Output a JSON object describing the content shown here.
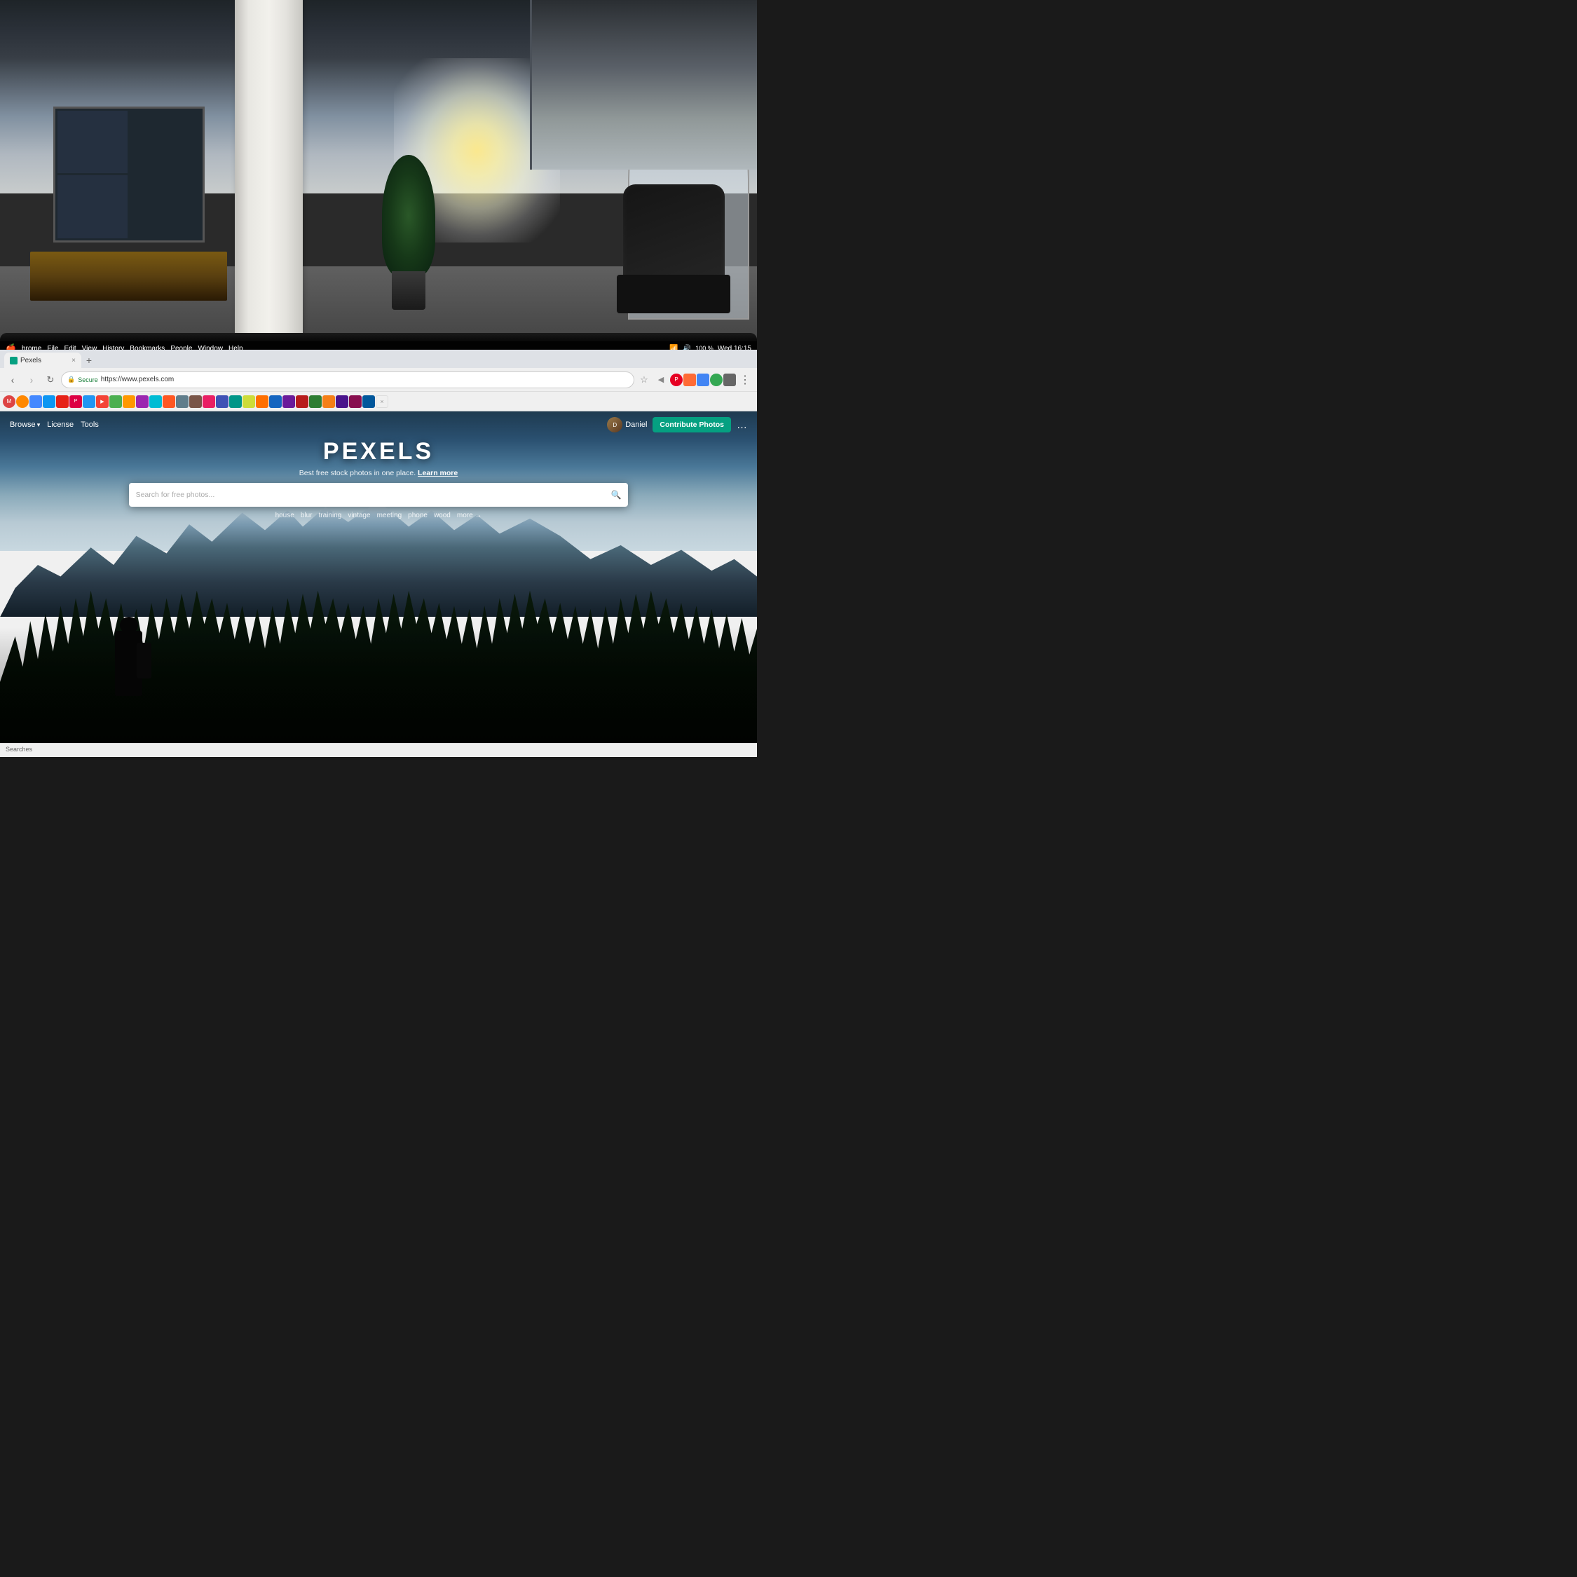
{
  "os": {
    "menubar": {
      "apple": "🍎",
      "items": [
        "hrome",
        "File",
        "Edit",
        "View",
        "History",
        "Bookmarks",
        "People",
        "Window",
        "Help"
      ],
      "right": {
        "time": "Wed 16:15",
        "battery": "100 %",
        "wifi": "▲",
        "volume": "🔊"
      }
    },
    "statusbar": {
      "text": "Searches"
    }
  },
  "browser": {
    "tab": {
      "favicon_color": "#05A081",
      "title": "Pexels",
      "close": "×"
    },
    "nav": {
      "back": "‹",
      "forward": "›",
      "refresh": "↻",
      "secure_label": "Secure",
      "url": "https://www.pexels.com",
      "bookmark_icon": "☆",
      "more_icon": "⋯"
    },
    "toolbar_colors": [
      "#d44",
      "#4a4",
      "#44d",
      "#d84",
      "#888",
      "#448",
      "#844",
      "#4a8",
      "#48a",
      "#a84",
      "#484",
      "#88a",
      "#a48",
      "#8a4",
      "#4a4",
      "#88a",
      "#a88",
      "#4a8",
      "#888",
      "#aaa",
      "#666",
      "#8a8",
      "#48a",
      "#a84",
      "#844",
      "#4a4",
      "#a4a",
      "#884"
    ]
  },
  "pexels": {
    "nav": {
      "browse_label": "Browse",
      "browse_arrow": "▾",
      "license_label": "License",
      "tools_label": "Tools",
      "user_name": "Daniel",
      "contribute_label": "Contribute Photos",
      "more_label": "…"
    },
    "hero": {
      "logo": "PEXELS",
      "tagline": "Best free stock photos in one place.",
      "learn_more": "Learn more",
      "search_placeholder": "Search for free photos...",
      "search_icon": "🔍",
      "tags": [
        "house",
        "blur",
        "training",
        "vintage",
        "meeting",
        "phone",
        "wood",
        "more →"
      ]
    }
  },
  "photo_bg": {
    "description": "Office interior with blurred background, white pillar, warm window light, plant, and chair"
  }
}
